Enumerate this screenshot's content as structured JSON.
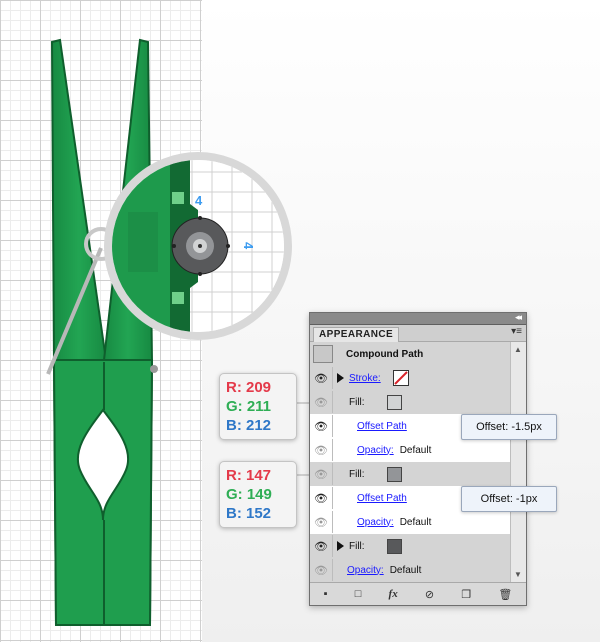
{
  "panel": {
    "title": "APPEARANCE",
    "object": "Compound Path",
    "rows": [
      {
        "kind": "stroke",
        "label": "Stroke:"
      },
      {
        "kind": "fill",
        "label": "Fill:",
        "color": "#d1d3d4"
      },
      {
        "kind": "effect",
        "label": "Offset Path"
      },
      {
        "kind": "opacity",
        "label": "Opacity:",
        "value": "Default"
      },
      {
        "kind": "fill",
        "label": "Fill:",
        "color": "#939598"
      },
      {
        "kind": "effect",
        "label": "Offset Path"
      },
      {
        "kind": "opacity",
        "label": "Opacity:",
        "value": "Default"
      },
      {
        "kind": "fill",
        "label": "Fill:",
        "color": "#58595b"
      },
      {
        "kind": "opacity",
        "label": "Opacity:",
        "value": "Default"
      }
    ],
    "bottom_fx": "fx"
  },
  "callouts": {
    "first": {
      "r": "R: 209",
      "g": "G: 211",
      "b": "B: 212"
    },
    "second": {
      "r": "R: 147",
      "g": "G: 149",
      "b": "B: 152"
    }
  },
  "offsets": {
    "first": "Offset: -1.5px",
    "second": "Offset: -1px"
  },
  "dimensions": {
    "top": "4",
    "right": "4"
  },
  "colors": {
    "clip_green": "#1e9a4c",
    "clip_dark": "#126a33",
    "accent_red": "#e43a4a",
    "accent_green": "#2fae55",
    "accent_blue": "#2f78c8"
  }
}
